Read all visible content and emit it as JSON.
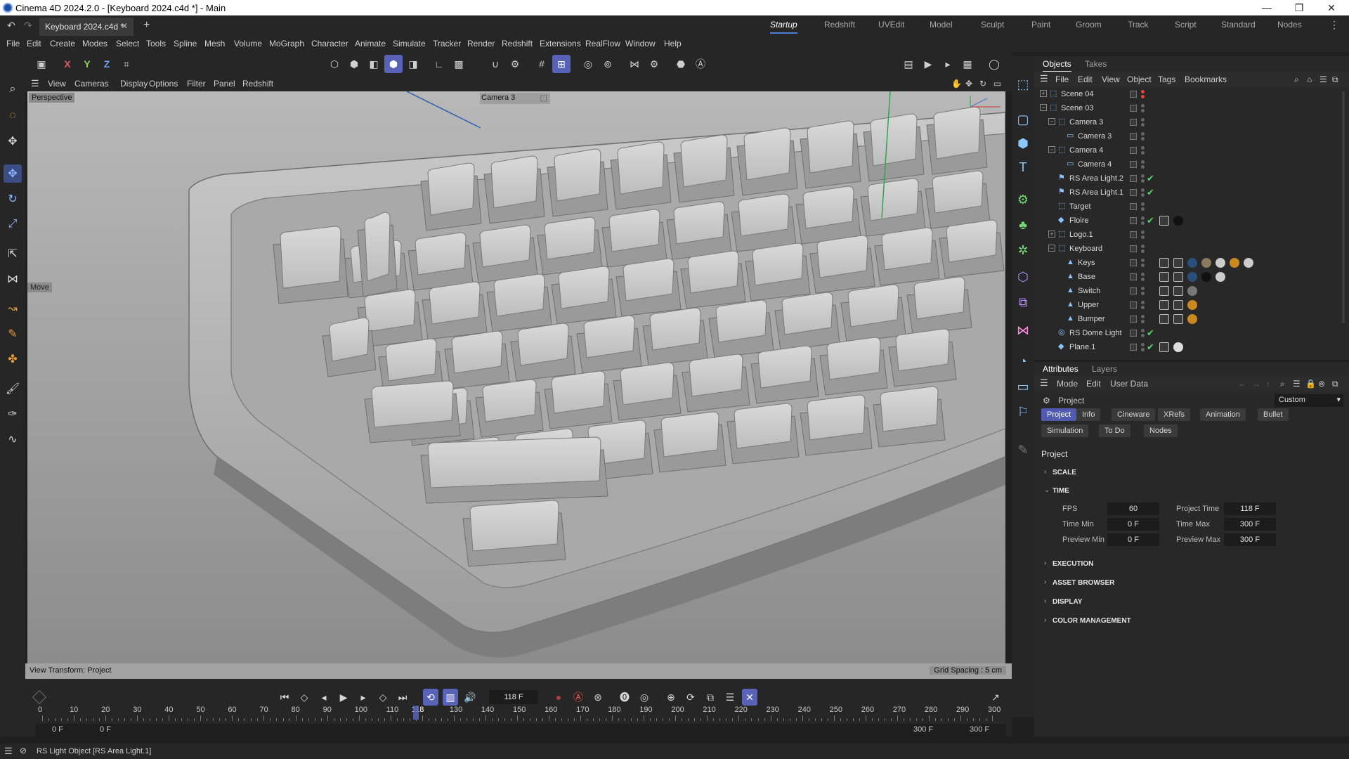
{
  "titlebar": {
    "title": "Cinema 4D 2024.2.0 - [Keyboard 2024.c4d *] - Main",
    "min": "—",
    "max": "❐",
    "close": "✕"
  },
  "tabs": {
    "doc": "Keyboard 2024.c4d *",
    "close": "✕",
    "add": "+"
  },
  "layouts": [
    "Startup",
    "Redshift",
    "UVEdit",
    "Model",
    "Sculpt",
    "Paint",
    "Groom",
    "Track",
    "Script",
    "Standard",
    "Nodes"
  ],
  "menu": [
    "File",
    "Edit",
    "Create",
    "Modes",
    "Select",
    "Tools",
    "Spline",
    "Mesh",
    "Volume",
    "MoGraph",
    "Character",
    "Animate",
    "Simulate",
    "Tracker",
    "Render",
    "Redshift",
    "Extensions",
    "RealFlow",
    "Window",
    "Help"
  ],
  "axes": {
    "x": "X",
    "y": "Y",
    "z": "Z"
  },
  "viewport_menu": [
    "View",
    "Cameras",
    "Display",
    "Options",
    "Filter",
    "Panel",
    "Redshift"
  ],
  "viewport": {
    "label": "Perspective",
    "camera": "Camera 3",
    "move": "Move",
    "status_left": "View Transform: Project",
    "status_right": "Grid Spacing : 5 cm"
  },
  "objects_tabs": [
    "Objects",
    "Takes"
  ],
  "objects_menu": [
    "File",
    "Edit",
    "View",
    "Object",
    "Tags",
    "Bookmarks"
  ],
  "objects": [
    {
      "name": "Scene 04",
      "depth": 0,
      "exp": "+",
      "icon": "null-icon",
      "check": false
    },
    {
      "name": "Scene 03",
      "depth": 0,
      "exp": "−",
      "icon": "null-icon",
      "check": false
    },
    {
      "name": "Camera 3",
      "depth": 1,
      "exp": "−",
      "icon": "null-icon",
      "check": false
    },
    {
      "name": "Camera 3",
      "depth": 2,
      "exp": "",
      "icon": "camera-icon",
      "check": false
    },
    {
      "name": "Camera 4",
      "depth": 1,
      "exp": "−",
      "icon": "null-icon",
      "check": false
    },
    {
      "name": "Camera 4",
      "depth": 2,
      "exp": "",
      "icon": "camera-icon",
      "check": false
    },
    {
      "name": "RS Area Light.2",
      "depth": 1,
      "exp": "",
      "icon": "light-icon",
      "check": true
    },
    {
      "name": "RS Area Light.1",
      "depth": 1,
      "exp": "",
      "icon": "light-icon",
      "check": true
    },
    {
      "name": "Target",
      "depth": 1,
      "exp": "",
      "icon": "null-icon",
      "check": false
    },
    {
      "name": "Floire",
      "depth": 1,
      "exp": "",
      "icon": "plane-icon",
      "check": true
    },
    {
      "name": "Logo.1",
      "depth": 1,
      "exp": "+",
      "icon": "null-icon",
      "check": false
    },
    {
      "name": "Keyboard",
      "depth": 1,
      "exp": "−",
      "icon": "null-icon",
      "check": false
    },
    {
      "name": "Keys",
      "depth": 2,
      "exp": "",
      "icon": "poly-icon",
      "check": false
    },
    {
      "name": "Base",
      "depth": 2,
      "exp": "",
      "icon": "poly-icon",
      "check": false
    },
    {
      "name": "Switch",
      "depth": 2,
      "exp": "",
      "icon": "poly-icon",
      "check": false
    },
    {
      "name": "Upper",
      "depth": 2,
      "exp": "",
      "icon": "poly-icon",
      "check": false
    },
    {
      "name": "Bumper",
      "depth": 2,
      "exp": "",
      "icon": "poly-icon",
      "check": false
    },
    {
      "name": "RS Dome Light",
      "depth": 1,
      "exp": "",
      "icon": "dome-icon",
      "check": true
    },
    {
      "name": "Plane.1",
      "depth": 1,
      "exp": "",
      "icon": "plane-icon",
      "check": true
    }
  ],
  "attr_tabs": [
    "Attributes",
    "Layers"
  ],
  "attr_menu": [
    "Mode",
    "Edit",
    "User Data"
  ],
  "attr": {
    "node": "Project",
    "preset": "Custom",
    "buttons1": [
      "Project",
      "Info",
      "Cineware",
      "XRefs",
      "Animation",
      "Bullet"
    ],
    "buttons2": [
      "Simulation",
      "To Do",
      "Nodes"
    ],
    "heading": "Project",
    "sections": {
      "scale": "SCALE",
      "time": "TIME",
      "execution": "EXECUTION",
      "asset": "ASSET BROWSER",
      "display": "DISPLAY",
      "color": "COLOR MANAGEMENT"
    },
    "fields": {
      "fps_label": "FPS",
      "fps": "60",
      "ptime_label": "Project Time",
      "ptime": "118 F",
      "tmin_label": "Time Min",
      "tmin": "0 F",
      "tmax_label": "Time Max",
      "tmax": "300 F",
      "pmin_label": "Preview Min",
      "pmin": "0 F",
      "pmax_label": "Preview Max",
      "pmax": "300 F"
    }
  },
  "timeline": {
    "current": "118 F",
    "current_frame": 118,
    "start": 0,
    "end": 300,
    "ticks": [
      "0",
      "10",
      "20",
      "30",
      "40",
      "50",
      "60",
      "70",
      "80",
      "90",
      "100",
      "110",
      "118",
      "130",
      "140",
      "150",
      "160",
      "170",
      "180",
      "190",
      "200",
      "210",
      "220",
      "230",
      "240",
      "250",
      "260",
      "270",
      "280",
      "290",
      "300"
    ],
    "range_left1": "0 F",
    "range_left2": "0 F",
    "range_right1": "300 F",
    "range_right2": "300 F"
  },
  "status": {
    "text": "RS Light Object [RS Area Light.1]"
  },
  "colors": {
    "accent": "#5863b8",
    "check": "#5bd06b",
    "dot_red": "#e2433a"
  }
}
